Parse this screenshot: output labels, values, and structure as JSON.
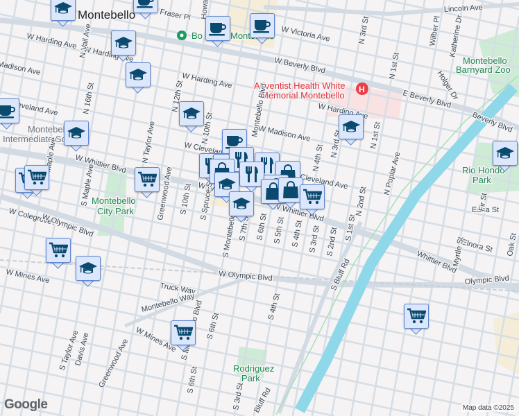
{
  "map": {
    "city_label": "Montebello",
    "poi_green_left": "Bo",
    "poi_green_right": "Montebello",
    "hospital": [
      "Adventist Health White",
      "Memorial Montebello"
    ],
    "hospital_icon": "H",
    "school": [
      "Montebello",
      "Intermediate School"
    ],
    "parks": {
      "city_park": [
        "Montebello",
        "City Park"
      ],
      "zoo": [
        "Montebello",
        "Barnyard Zoo"
      ],
      "rio_hondo": [
        "Rio Hondo",
        "Park"
      ],
      "rodriguez": [
        "Rodriguez",
        "Park"
      ]
    },
    "streets": [
      "W Harding Ave",
      "W Harding Ave",
      "W Harding Ave",
      "W Harding Ave",
      "Madison Ave",
      "W Madison Ave",
      "Cleveland Ave",
      "W Cleveland Ave",
      "Cleveland Ave",
      "N Vail Ave",
      "N 16th St",
      "N Taylor Ave",
      "N 12th St",
      "N 10th St",
      "Montebello Blvd",
      "Howard Ave",
      "W Whittier Blvd",
      "W Whittier Blvd",
      "W Whittier Blvd",
      "Whittier Blvd",
      "W Colegrove Ave",
      "W Olympic Blvd",
      "W Mines Ave",
      "W Olympic Blvd",
      "Truck Way",
      "Montebello Way",
      "W Mines Ave",
      "Greenwood Ave",
      "S Taylor Ave",
      "Davis Ave",
      "S 6th St",
      "S 6th St",
      "S Montebello Blvd",
      "S 4th St",
      "S 3rd St",
      "Bluff Rd",
      "S Bluff Rd",
      "S Spruce St",
      "S Montebello Blvd",
      "S 7th St",
      "S 6th St",
      "S 5th St",
      "S 4th St",
      "S 3rd St",
      "S 2nd St",
      "S 1st St",
      "N 2nd St",
      "N 1st St",
      "N Poplar Ave",
      "N 3rd St",
      "N 4th St",
      "N 3rd St",
      "N 1st St",
      "Wilber Pl",
      "Katherine Dr",
      "Holger Dr",
      "Lincoln Ave",
      "W Victoria Ave",
      "W Beverly Blvd",
      "E Beverly Blvd",
      "Beverly Blvd",
      "S 10th St",
      "Greenwood Ave",
      "S Maple Ave",
      "Edna St",
      "Elnora St",
      "Myrtle St",
      "Fir St",
      "Oak St",
      "Olympic Blvd",
      "Fraser Pl",
      "N Maple Ave"
    ],
    "markers": [
      {
        "icon": "graduation-cap-icon"
      },
      {
        "icon": "graduation-cap-icon"
      },
      {
        "icon": "graduation-cap-icon"
      },
      {
        "icon": "graduation-cap-icon"
      },
      {
        "icon": "graduation-cap-icon"
      },
      {
        "icon": "graduation-cap-icon"
      },
      {
        "icon": "graduation-cap-icon"
      },
      {
        "icon": "graduation-cap-icon"
      },
      {
        "icon": "coffee-cup-icon"
      },
      {
        "icon": "coffee-cup-icon"
      },
      {
        "icon": "coffee-cup-icon"
      },
      {
        "icon": "coffee-cup-icon"
      },
      {
        "icon": "coffee-cup-icon"
      },
      {
        "icon": "restaurant-icon"
      },
      {
        "icon": "restaurant-icon"
      },
      {
        "icon": "restaurant-icon"
      },
      {
        "icon": "restaurant-icon"
      },
      {
        "icon": "restaurant-icon"
      },
      {
        "icon": "shopping-bag-icon"
      },
      {
        "icon": "shopping-bag-icon"
      },
      {
        "icon": "shopping-bag-icon"
      },
      {
        "icon": "shopping-bag-icon"
      },
      {
        "icon": "shopping-bag-icon"
      },
      {
        "icon": "graduation-cap-icon"
      },
      {
        "icon": "graduation-cap-icon"
      },
      {
        "icon": "shopping-cart-icon"
      },
      {
        "icon": "shopping-cart-icon"
      },
      {
        "icon": "shopping-cart-icon"
      },
      {
        "icon": "shopping-cart-icon"
      },
      {
        "icon": "shopping-cart-icon"
      },
      {
        "icon": "shopping-cart-icon"
      },
      {
        "icon": "shopping-cart-icon"
      }
    ],
    "colors": {
      "marker_fill": "#dce7fb",
      "marker_border": "#5d86d2",
      "icon": "#0b4a6f",
      "river": "#8fd8ea",
      "park": "#cdebd5",
      "hospital_area": "#fbe2e2"
    }
  },
  "footer": {
    "logo": "Google",
    "attribution": "Map data ©2025"
  }
}
